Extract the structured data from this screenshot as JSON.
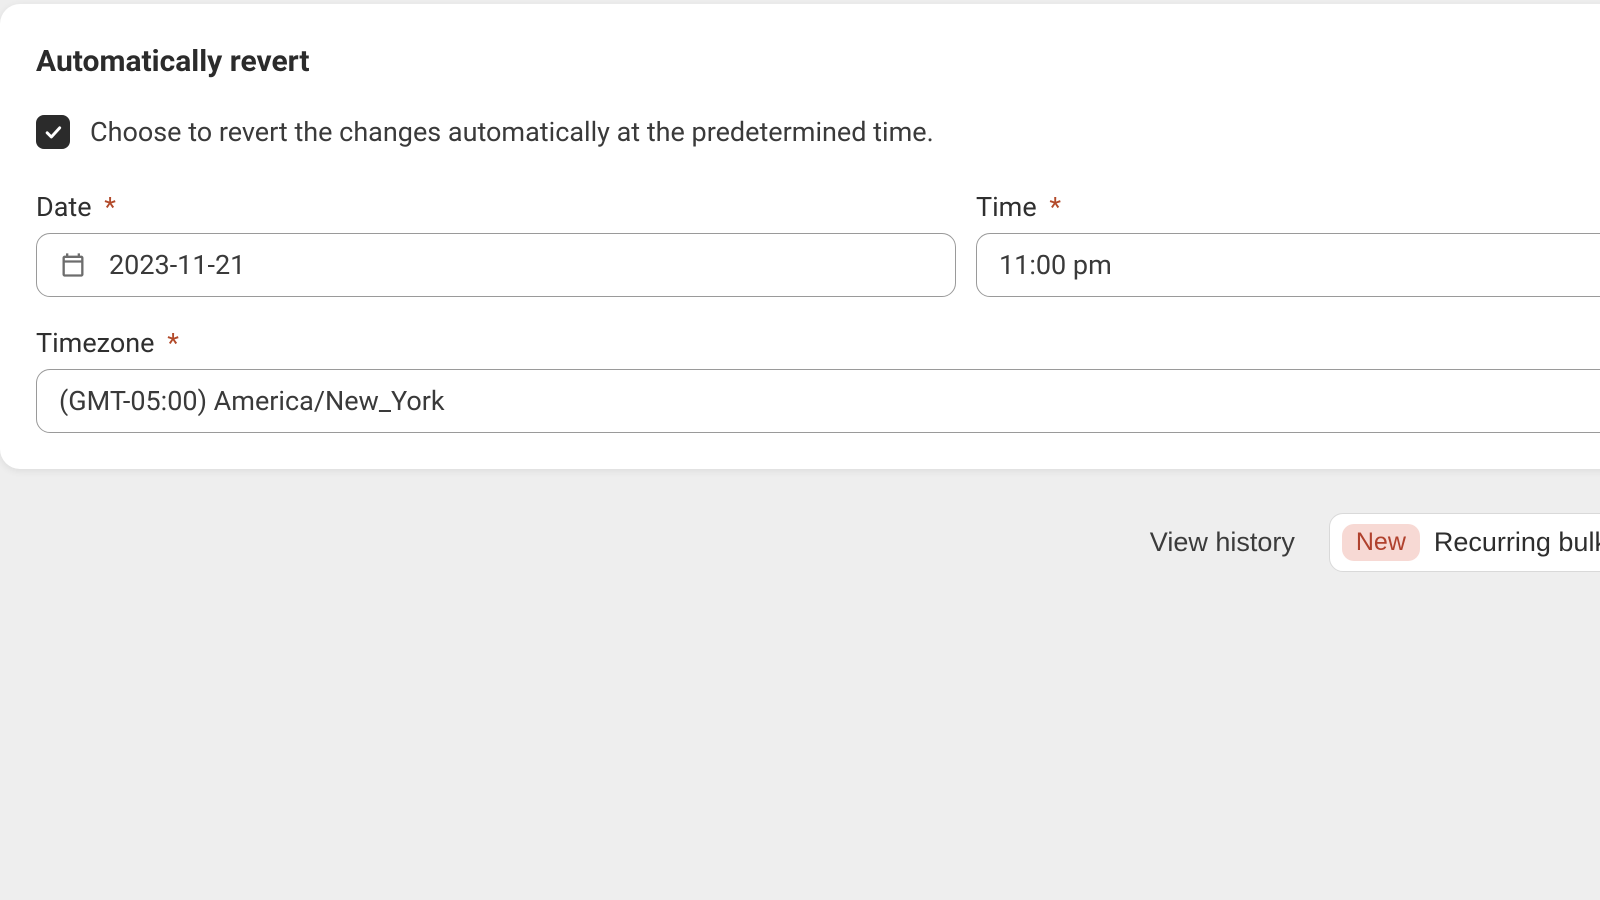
{
  "card": {
    "title": "Automatically revert",
    "checkbox_label": "Choose to revert the changes automatically at the predetermined time."
  },
  "fields": {
    "date_label": "Date",
    "date_value": "2023-11-21",
    "time_label": "Time",
    "time_value": "11:00 pm",
    "tz_label": "Timezone",
    "tz_value": "(GMT-05:00) America/New_York",
    "required_mark": "*"
  },
  "footer": {
    "view_history": "View history",
    "badge": "New",
    "recurring": "Recurring bulk edit"
  }
}
